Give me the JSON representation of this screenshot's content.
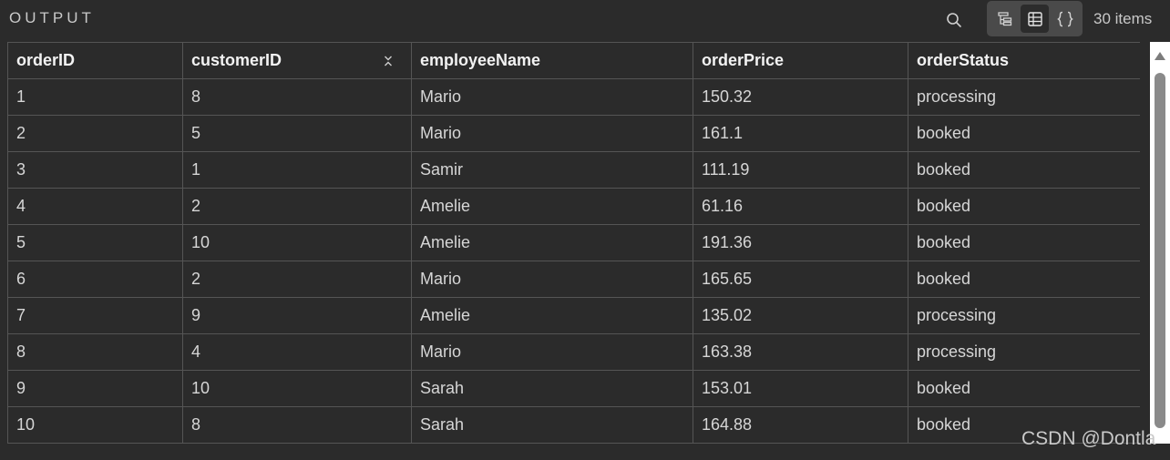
{
  "panel": {
    "title": "OUTPUT",
    "items_count": "30 items"
  },
  "toolbar": {
    "search_icon": "search-icon",
    "views": [
      {
        "icon": "tree-view-icon",
        "active": false
      },
      {
        "icon": "table-view-icon",
        "active": true
      },
      {
        "icon": "json-view-icon",
        "active": false
      }
    ]
  },
  "table": {
    "columns": [
      "orderID",
      "customerID",
      "employeeName",
      "orderPrice",
      "orderStatus"
    ],
    "rows": [
      [
        "1",
        "8",
        "Mario",
        "150.32",
        "processing"
      ],
      [
        "2",
        "5",
        "Mario",
        "161.1",
        "booked"
      ],
      [
        "3",
        "1",
        "Samir",
        "111.19",
        "booked"
      ],
      [
        "4",
        "2",
        "Amelie",
        "61.16",
        "booked"
      ],
      [
        "5",
        "10",
        "Amelie",
        "191.36",
        "booked"
      ],
      [
        "6",
        "2",
        "Mario",
        "165.65",
        "booked"
      ],
      [
        "7",
        "9",
        "Amelie",
        "135.02",
        "processing"
      ],
      [
        "8",
        "4",
        "Mario",
        "163.38",
        "processing"
      ],
      [
        "9",
        "10",
        "Sarah",
        "153.01",
        "booked"
      ],
      [
        "10",
        "8",
        "Sarah",
        "164.88",
        "booked"
      ]
    ]
  },
  "watermark": "CSDN @Dontla",
  "colors": {
    "background": "#2b2b2b",
    "border": "#555555",
    "toggle_group": "#4a4a4a",
    "scrollbar_track": "#ffffff",
    "scrollbar_thumb": "#8a8a8a"
  }
}
